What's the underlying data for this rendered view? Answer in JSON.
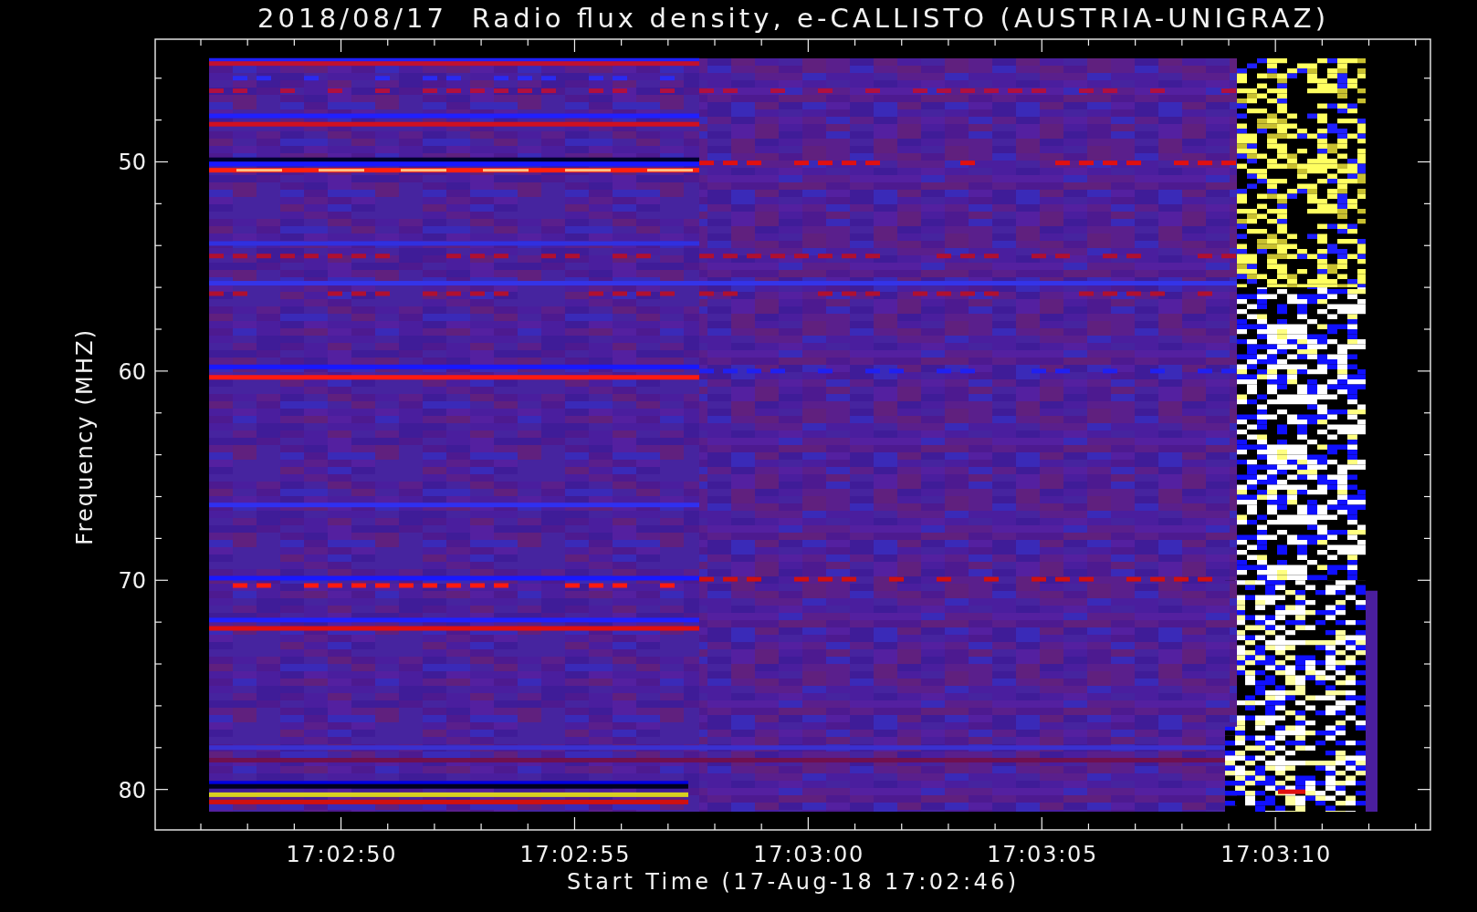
{
  "chart": {
    "title": "2018/08/17  Radio flux density, e-CALLISTO (AUSTRIA-UNIGRAZ)",
    "ylabel": "Frequency (MHZ)",
    "xlabel": "Start Time (17-Aug-18 17:02:46)",
    "yticks": [
      "50",
      "60",
      "70",
      "80"
    ],
    "xticks": [
      "17:02:50",
      "17:02:55",
      "17:03:00",
      "17:03:05",
      "17:03:10"
    ]
  }
}
